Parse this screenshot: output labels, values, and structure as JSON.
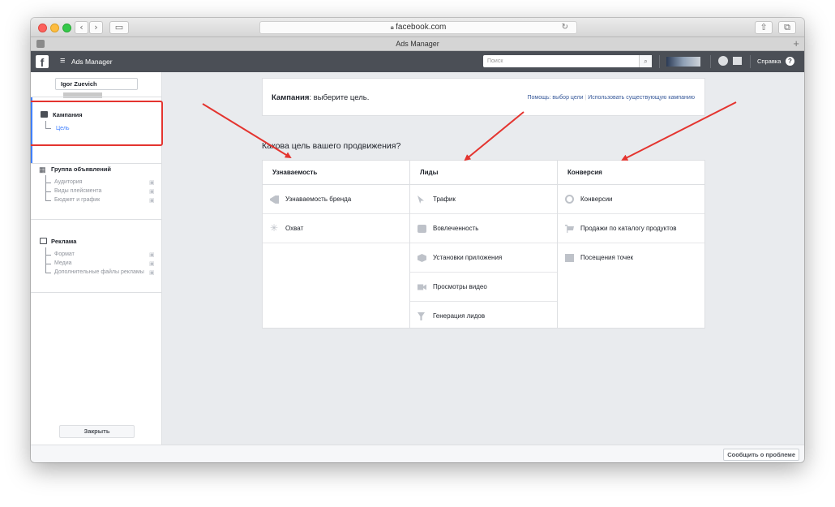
{
  "browser": {
    "url": "facebook.com",
    "tab_title": "Ads Manager"
  },
  "fb_header": {
    "app_name": "Ads Manager",
    "search_placeholder": "Поиск",
    "help_label": "Справка"
  },
  "sidebar": {
    "user_name": "Igor Zuevich",
    "campaign": {
      "title": "Кампания",
      "items": [
        "Цель"
      ]
    },
    "adset": {
      "title": "Группа объявлений",
      "items": [
        "Аудитория",
        "Виды плейсмента",
        "Бюджет и график"
      ]
    },
    "ad": {
      "title": "Реклама",
      "items": [
        "Формат",
        "Медиа",
        "Дополнительные файлы рекламы"
      ]
    },
    "close_label": "Закрыть"
  },
  "main": {
    "header_bold": "Кампания",
    "header_rest": ": выберите цель.",
    "help_link": "Помощь: выбор цели",
    "existing_link": "Использовать существующую кампанию",
    "question": "Какова цель вашего продвижения?",
    "columns": [
      {
        "title": "Узнаваемость",
        "items": [
          {
            "label": "Узнаваемость бренда",
            "icon": "megaphone-icon"
          },
          {
            "label": "Охват",
            "icon": "reach-icon"
          }
        ]
      },
      {
        "title": "Лиды",
        "items": [
          {
            "label": "Трафик",
            "icon": "cursor-icon"
          },
          {
            "label": "Вовлеченность",
            "icon": "chat-icon"
          },
          {
            "label": "Установки приложения",
            "icon": "box-icon"
          },
          {
            "label": "Просмотры видео",
            "icon": "video-icon"
          },
          {
            "label": "Генерация лидов",
            "icon": "funnel-icon"
          }
        ]
      },
      {
        "title": "Конверсия",
        "items": [
          {
            "label": "Конверсии",
            "icon": "globe-icon"
          },
          {
            "label": "Продажи по каталогу продуктов",
            "icon": "cart-icon"
          },
          {
            "label": "Посещения точек",
            "icon": "store-icon"
          }
        ]
      }
    ]
  },
  "footer": {
    "report_label": "Сообщить о проблеме"
  },
  "colors": {
    "fb_header": "#4b4f56",
    "link": "#365899",
    "highlight": "#e4342f",
    "active_blue": "#4080ff"
  }
}
